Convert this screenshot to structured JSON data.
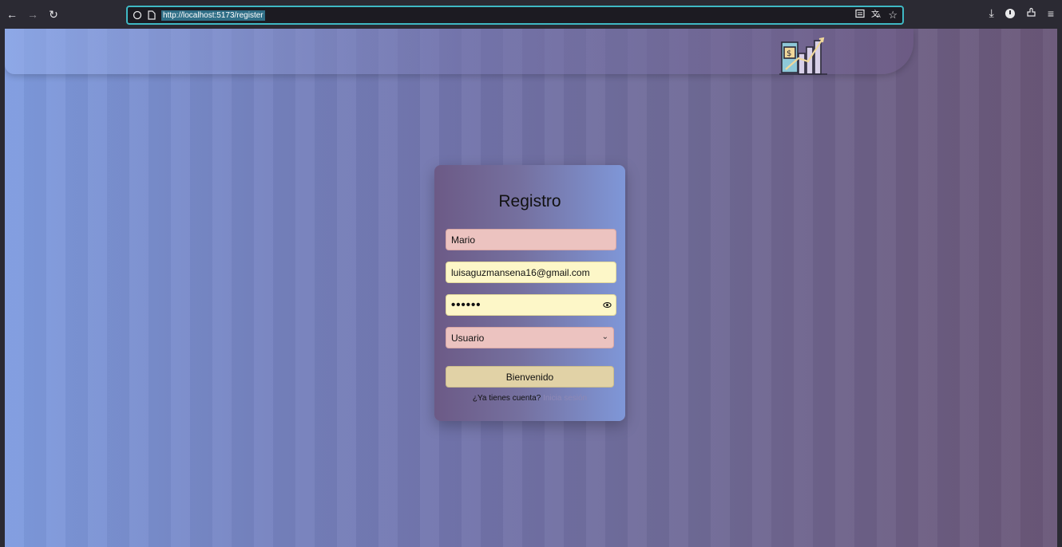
{
  "browser": {
    "url": "http://localhost:5173/register",
    "icons": [
      "back-icon",
      "forward-icon",
      "reload-icon",
      "shield-icon",
      "page-icon",
      "reader-view-icon",
      "translate-icon",
      "bookmark-star-icon",
      "download-icon",
      "account-icon",
      "extensions-icon",
      "menu-icon"
    ]
  },
  "form": {
    "title": "Registro",
    "name_value": "Mario",
    "email_value": "luisaguzmansena16@gmail.com",
    "password_mask": "••••••",
    "role_value": "Usuario",
    "submit_label": "Bienvenido",
    "login_prompt": "¿Ya tienes cuenta?",
    "login_link": "Inicia sesión"
  },
  "colors": {
    "url_focus_border": "#3fb8c4",
    "name_field_bg": "#ecc3c0",
    "email_field_bg": "#fdf7c8",
    "button_bg": "#e1d2a6"
  }
}
